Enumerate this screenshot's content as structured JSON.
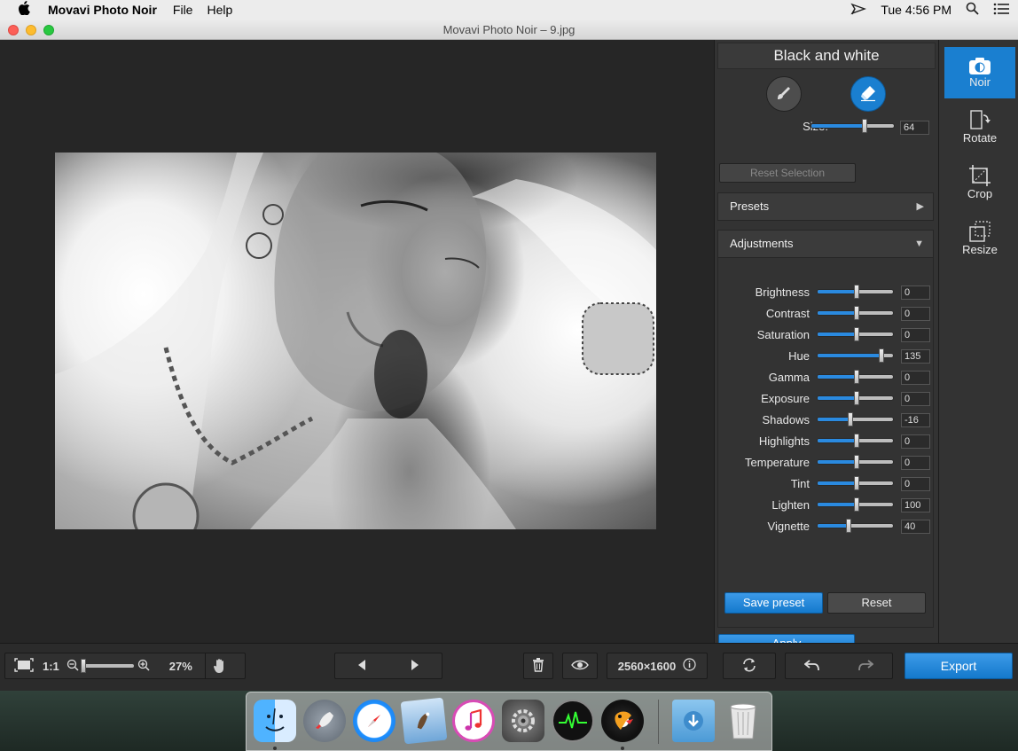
{
  "menubar": {
    "app_name": "Movavi Photo Noir",
    "items": [
      "File",
      "Help"
    ],
    "clock": "Tue 4:56 PM"
  },
  "window": {
    "title": "Movavi Photo Noir – 9.jpg"
  },
  "panel": {
    "title": "Black and white",
    "size_label": "Size:",
    "size_value": "64",
    "reset_selection": "Reset Selection",
    "presets_label": "Presets",
    "adjustments_label": "Adjustments",
    "adjustments": [
      {
        "label": "Brightness",
        "value": "0",
        "level": 0.5
      },
      {
        "label": "Contrast",
        "value": "0",
        "level": 0.5
      },
      {
        "label": "Saturation",
        "value": "0",
        "level": 0.5
      },
      {
        "label": "Hue",
        "value": "135",
        "level": 0.85
      },
      {
        "label": "Gamma",
        "value": "0",
        "level": 0.5
      },
      {
        "label": "Exposure",
        "value": "0",
        "level": 0.5
      },
      {
        "label": "Shadows",
        "value": "-16",
        "level": 0.42
      },
      {
        "label": "Highlights",
        "value": "0",
        "level": 0.5
      },
      {
        "label": "Temperature",
        "value": "0",
        "level": 0.5
      },
      {
        "label": "Tint",
        "value": "0",
        "level": 0.5
      },
      {
        "label": "Lighten",
        "value": "100",
        "level": 0.5
      },
      {
        "label": "Vignette",
        "value": "40",
        "level": 0.4
      }
    ],
    "size_level": 0.64,
    "save_preset": "Save preset",
    "reset": "Reset",
    "apply": "Apply"
  },
  "sidetools": [
    {
      "label": "Noir",
      "icon": "camera-icon",
      "active": true
    },
    {
      "label": "Rotate",
      "icon": "rotate-icon",
      "active": false
    },
    {
      "label": "Crop",
      "icon": "crop-icon",
      "active": false
    },
    {
      "label": "Resize",
      "icon": "resize-icon",
      "active": false
    }
  ],
  "bottombar": {
    "zoom_ratio": "1:1",
    "zoom_percent": "27%",
    "zoom_level": 0.0,
    "dimensions": "2560×1600",
    "export": "Export"
  },
  "dock": {
    "apps": [
      "finder-icon",
      "launchpad-icon",
      "safari-icon",
      "mail-icon",
      "itunes-icon",
      "system-preferences-icon",
      "activity-monitor-icon",
      "photo-noir-icon",
      "downloads-icon",
      "trash-icon"
    ]
  },
  "colors": {
    "accent": "#1a7fd0",
    "panel": "#333333",
    "canvas": "#262626"
  }
}
